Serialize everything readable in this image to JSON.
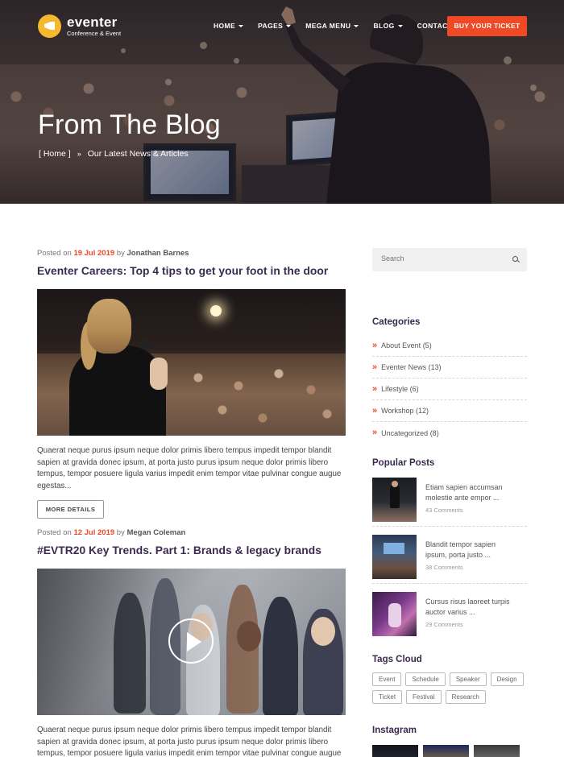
{
  "brand": {
    "name": "eventer",
    "tagline": "Conference & Event"
  },
  "nav": {
    "items": [
      {
        "label": "HOME"
      },
      {
        "label": "PAGES"
      },
      {
        "label": "MEGA MENU"
      },
      {
        "label": "BLOG"
      },
      {
        "label": "CONTACTS"
      }
    ],
    "cta": "BUY YOUR TICKET"
  },
  "hero": {
    "title": "From The Blog",
    "breadcrumb_home": "[ Home ]",
    "breadcrumb_sep": "»",
    "breadcrumb_current": "Our Latest News & Articles"
  },
  "posts": [
    {
      "posted_on": "Posted on",
      "date": "19 Jul 2019",
      "by": "by",
      "author": "Jonathan Barnes",
      "title": "Eventer Careers: Top 4 tips to get your foot in the door",
      "excerpt": "Quaerat neque purus ipsum neque dolor primis libero tempus impedit tempor blandit sapien at gravida donec ipsum, at porta justo purus ipsum neque dolor primis libero tempus, tempor posuere ligula varius impedit enim tempor vitae pulvinar congue augue egestas...",
      "button": "MORE DETAILS"
    },
    {
      "posted_on": "Posted on",
      "date": "12 Jul 2019",
      "by": "by",
      "author": "Megan Coleman",
      "title": "#EVTR20 Key Trends. Part 1: Brands & legacy brands",
      "excerpt": "Quaerat neque purus ipsum neque dolor primis libero tempus impedit tempor blandit sapien at gravida donec ipsum, at porta justo purus ipsum neque dolor primis libero tempus, tempor posuere ligula varius impedit enim tempor vitae pulvinar congue augue egestas..."
    }
  ],
  "sidebar": {
    "search_placeholder": "Search",
    "categories_title": "Categories",
    "categories": [
      {
        "name": "About Event",
        "count": "(5)"
      },
      {
        "name": "Eventer News",
        "count": "(13)"
      },
      {
        "name": "Lifestyle",
        "count": "(6)"
      },
      {
        "name": "Workshop",
        "count": "(12)"
      },
      {
        "name": "Uncategorized",
        "count": "(8)"
      }
    ],
    "popular_title": "Popular Posts",
    "popular": [
      {
        "title": "Etiam sapien accumsan molestie ante empor ...",
        "comments": "43 Comments"
      },
      {
        "title": "Blandit tempor sapien ipsum, porta justo ...",
        "comments": "38 Comments"
      },
      {
        "title": "Cursus risus laoreet turpis auctor varius ...",
        "comments": "29 Comments"
      }
    ],
    "tags_title": "Tags Cloud",
    "tags": [
      "Event",
      "Schedule",
      "Speaker",
      "Design",
      "Ticket",
      "Festival",
      "Research"
    ],
    "instagram_title": "Instagram"
  },
  "colors": {
    "accent": "#ef4a25",
    "heading": "#3a2a4f",
    "logo": "#f5b82e"
  }
}
